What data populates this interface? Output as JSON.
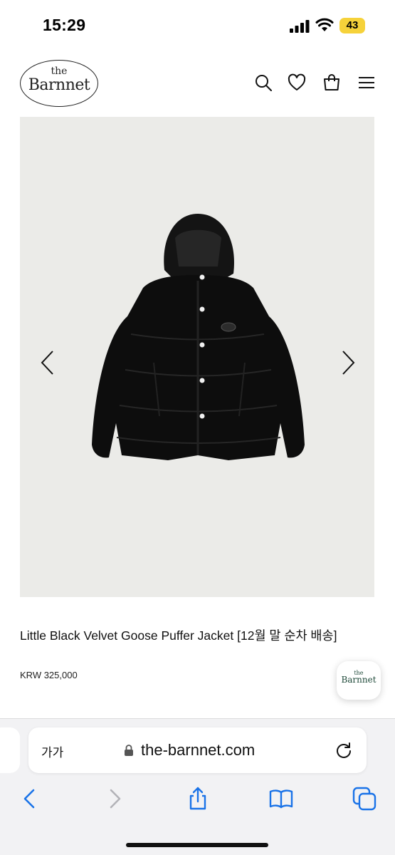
{
  "status_bar": {
    "time": "15:29",
    "battery": "43",
    "icons": [
      "signal-icon",
      "wifi-icon"
    ]
  },
  "header": {
    "logo_small": "the",
    "logo_name": "Barnnet",
    "icons": [
      "search-icon",
      "heart-icon",
      "bag-icon",
      "menu-icon"
    ]
  },
  "product": {
    "image_alt": "Little Black Velvet Goose Puffer Jacket",
    "title": "Little Black Velvet Goose Puffer Jacket [12월 말 순차 배송]",
    "price": "KRW 325,000"
  },
  "floating_badge": {
    "small": "the",
    "name": "Barnnet"
  },
  "browser": {
    "text_size_label": "가가",
    "url": "the-barnnet.com",
    "toolbar_icons": [
      "back-icon",
      "forward-icon",
      "share-icon",
      "bookmarks-icon",
      "tabs-icon"
    ]
  },
  "colors": {
    "accent": "#1a73e8",
    "battery": "#f6d23a",
    "image_bg": "#ebebe8"
  }
}
